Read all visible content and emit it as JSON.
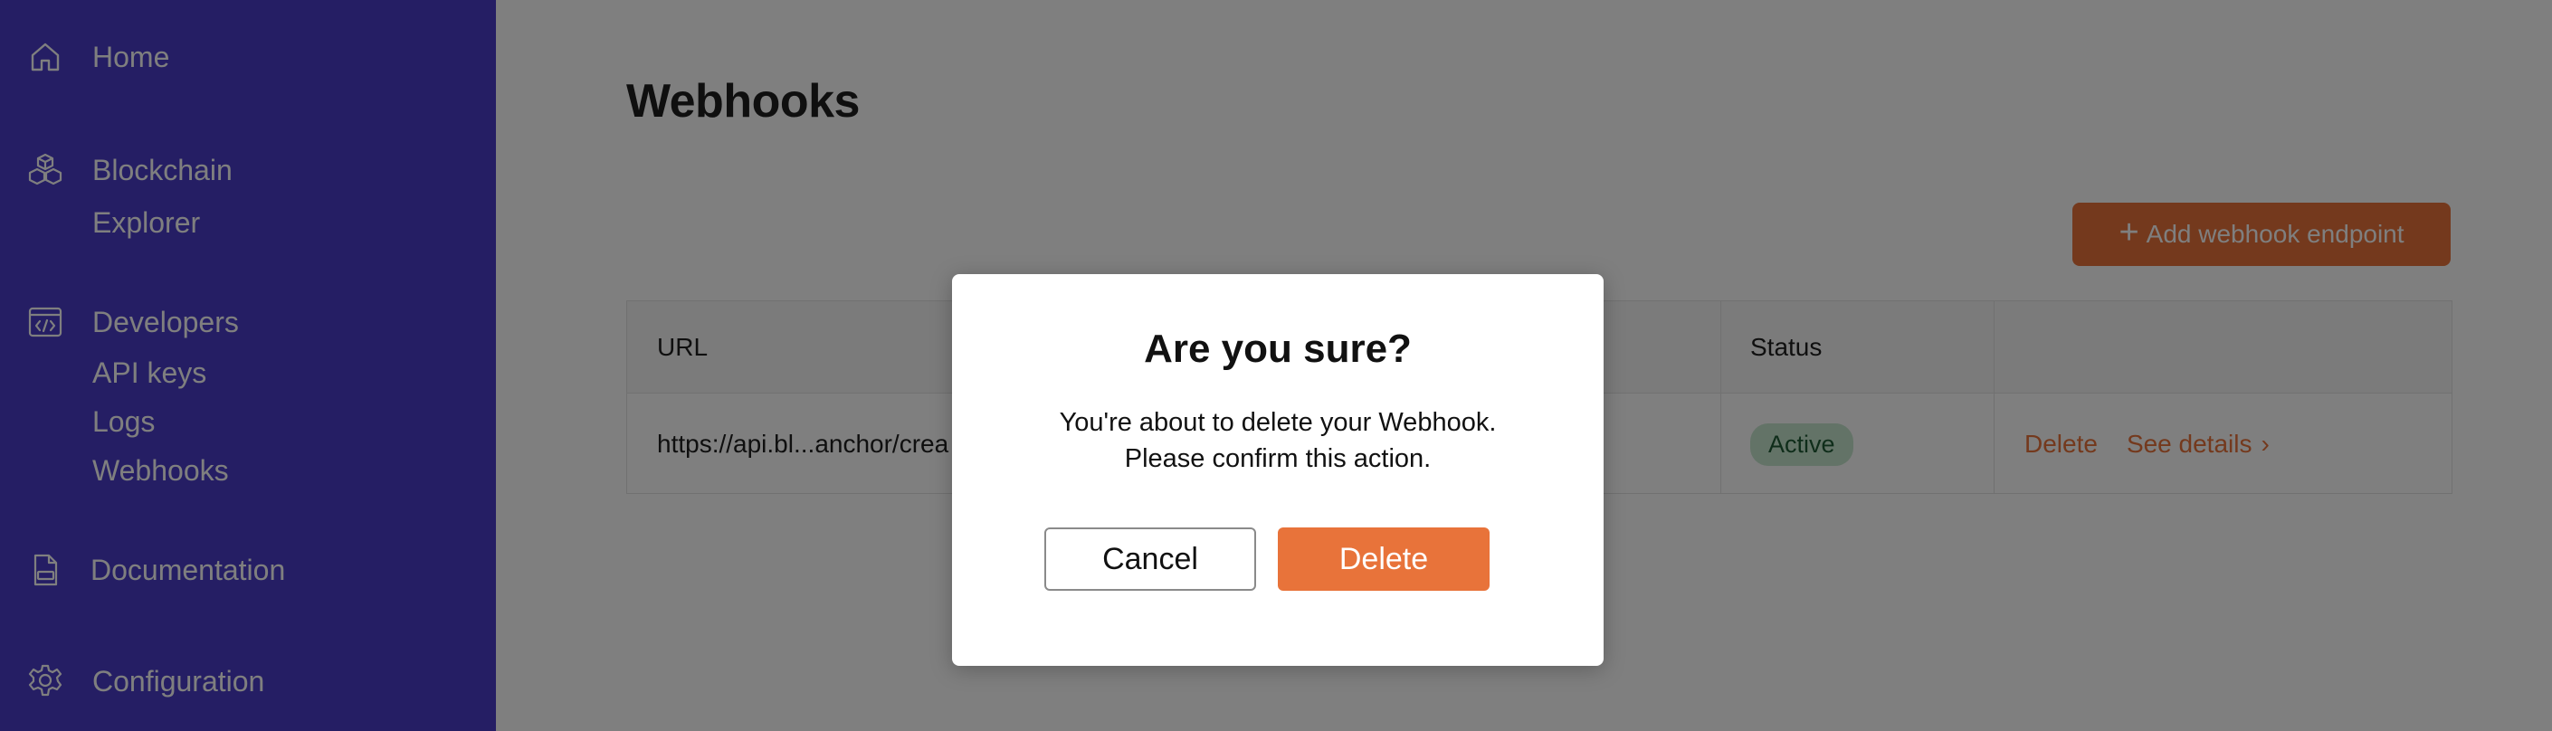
{
  "colors": {
    "sidebar_bg": "#4a3cc9",
    "accent": "#e8733a",
    "badge_bg": "#c6e6cf",
    "overlay": "rgba(0,0,0,0.5)"
  },
  "sidebar": {
    "items": [
      {
        "label": "Home",
        "icon": "home-icon"
      },
      {
        "label": "Blockchain",
        "icon": "cubes-icon",
        "subitems": [
          "Explorer"
        ]
      },
      {
        "label": "Developers",
        "icon": "code-window-icon",
        "subitems": [
          "API keys",
          "Logs",
          "Webhooks"
        ]
      },
      {
        "label": "Documentation",
        "icon": "doc-file-icon"
      },
      {
        "label": "Configuration",
        "icon": "gear-icon"
      }
    ]
  },
  "main": {
    "title": "Webhooks",
    "add_button": {
      "label": "Add webhook endpoint",
      "icon": "plus-icon"
    },
    "table": {
      "columns": [
        "URL",
        "Status"
      ],
      "rows": [
        {
          "url": "https://api.bl...anchor/crea",
          "status": "Active",
          "actions": {
            "delete": "Delete",
            "details": "See details"
          }
        }
      ]
    }
  },
  "modal": {
    "title": "Are you sure?",
    "message_line1": "You're about to delete your Webhook.",
    "message_line2": "Please confirm this action.",
    "cancel_label": "Cancel",
    "delete_label": "Delete"
  }
}
